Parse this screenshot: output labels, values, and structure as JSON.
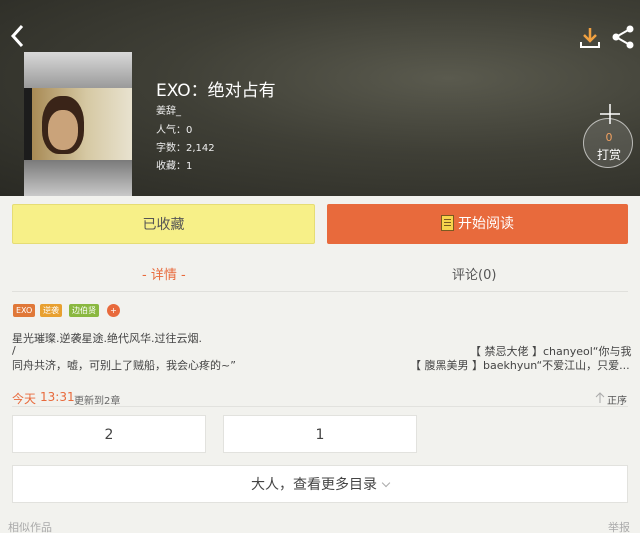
{
  "header": {
    "title": "EXO：绝对占有",
    "author": "姜辞_",
    "popularity": "人气：0",
    "word_count": "字数：2,142",
    "favorites": "收藏：1"
  },
  "tip": {
    "count": "0",
    "label": "打赏"
  },
  "actions": {
    "favorite_label": "已收藏",
    "read_label": "开始阅读"
  },
  "tabs": {
    "detail": "- 详情 -",
    "comments": "评论(0)"
  },
  "tags": [
    {
      "label": "EXO",
      "color": "#e07838"
    },
    {
      "label": "逆袭",
      "color": "#e8a030"
    },
    {
      "label": "边伯贤",
      "color": "#8ab840"
    },
    {
      "label": "+",
      "color": "#e86a3c"
    }
  ],
  "synopsis": {
    "line1": "星光璀璨.逆袭星途.绝代风华.过往云烟.",
    "line2": "/",
    "line3": "同舟共济，嘘，可别上了贼船，我会心疼的~”",
    "right1": "【 禁忌大佬 】chanyeol“你与我",
    "right2": "【 腹黑美男 】baekhyun“不爱江山，只爱..."
  },
  "update": {
    "day": "今天",
    "time": "13:31",
    "text": "更新到2章",
    "sort": "正序"
  },
  "chapters": [
    "2",
    "1"
  ],
  "more_catalog": "大人，查看更多目录",
  "footer": {
    "left": "相似作品",
    "right": "举报"
  }
}
